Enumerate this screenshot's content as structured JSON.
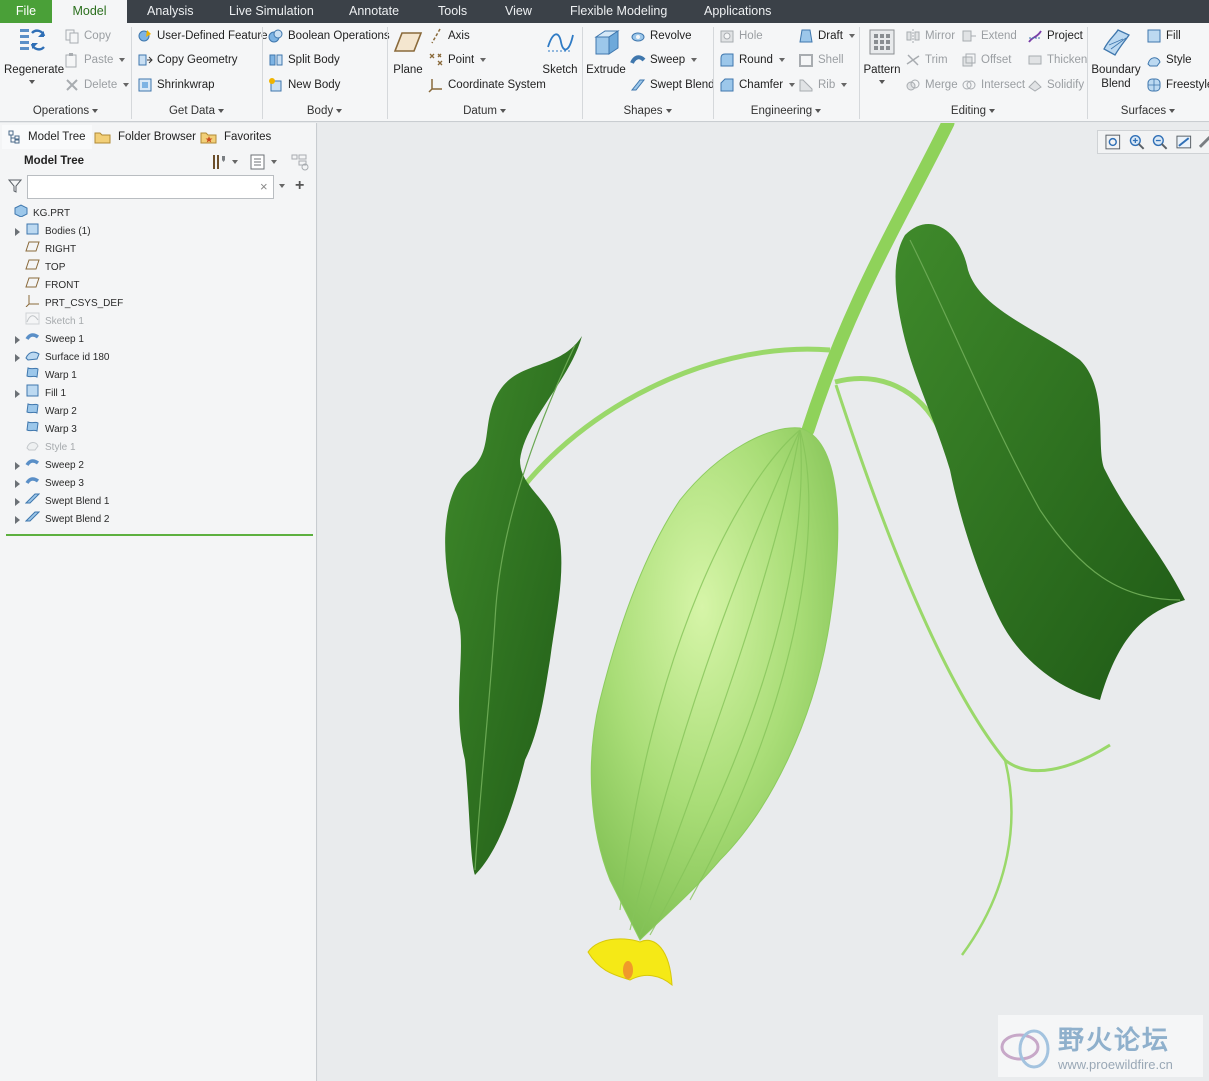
{
  "menubar": {
    "tabs": [
      "File",
      "Model",
      "Analysis",
      "Live Simulation",
      "Annotate",
      "Tools",
      "View",
      "Flexible Modeling",
      "Applications"
    ]
  },
  "ribbon": {
    "operations": {
      "label": "Operations",
      "regenerate": "Regenerate",
      "copy": "Copy",
      "paste": "Paste",
      "delete": "Delete"
    },
    "get_data": {
      "label": "Get Data",
      "user_defined_feature": "User-Defined Feature",
      "copy_geometry": "Copy Geometry",
      "shrinkwrap": "Shrinkwrap"
    },
    "body": {
      "label": "Body",
      "boolean_operations": "Boolean Operations",
      "split_body": "Split Body",
      "new_body": "New Body"
    },
    "datum": {
      "label": "Datum",
      "plane": "Plane",
      "axis": "Axis",
      "point": "Point",
      "coordinate_system": "Coordinate System",
      "sketch": "Sketch"
    },
    "shapes": {
      "label": "Shapes",
      "extrude": "Extrude",
      "revolve": "Revolve",
      "sweep": "Sweep",
      "swept_blend": "Swept Blend"
    },
    "engineering": {
      "label": "Engineering",
      "hole": "Hole",
      "round": "Round",
      "chamfer": "Chamfer",
      "draft": "Draft",
      "shell": "Shell",
      "rib": "Rib"
    },
    "editing": {
      "label": "Editing",
      "pattern": "Pattern",
      "mirror": "Mirror",
      "trim": "Trim",
      "merge": "Merge",
      "extend": "Extend",
      "offset": "Offset",
      "intersect": "Intersect",
      "project": "Project",
      "thicken": "Thicken",
      "solidify": "Solidify"
    },
    "surfaces": {
      "label": "Surfaces",
      "boundary_blend_1": "Boundary",
      "boundary_blend_2": "Blend",
      "fill": "Fill",
      "style": "Style",
      "freestyle": "Freestyle"
    }
  },
  "panel": {
    "tabs": [
      "Model Tree",
      "Folder Browser",
      "Favorites"
    ],
    "header": "Model Tree",
    "filter_placeholder": "",
    "tree": [
      {
        "label": "KG.PRT",
        "expandable": false,
        "dim": false,
        "icon": "part-icon"
      },
      {
        "label": "Bodies (1)",
        "expandable": true,
        "dim": false,
        "icon": "bodies-icon"
      },
      {
        "label": "RIGHT",
        "expandable": false,
        "dim": false,
        "icon": "datum-plane-icon"
      },
      {
        "label": "TOP",
        "expandable": false,
        "dim": false,
        "icon": "datum-plane-icon"
      },
      {
        "label": "FRONT",
        "expandable": false,
        "dim": false,
        "icon": "datum-plane-icon"
      },
      {
        "label": "PRT_CSYS_DEF",
        "expandable": false,
        "dim": false,
        "icon": "csys-icon"
      },
      {
        "label": "Sketch 1",
        "expandable": false,
        "dim": true,
        "icon": "sketch-icon"
      },
      {
        "label": "Sweep 1",
        "expandable": true,
        "dim": false,
        "icon": "sweep-icon"
      },
      {
        "label": "Surface id 180",
        "expandable": true,
        "dim": false,
        "icon": "surface-icon"
      },
      {
        "label": "Warp 1",
        "expandable": false,
        "dim": false,
        "icon": "warp-icon"
      },
      {
        "label": "Fill 1",
        "expandable": true,
        "dim": false,
        "icon": "fill-icon"
      },
      {
        "label": "Warp 2",
        "expandable": false,
        "dim": false,
        "icon": "warp-icon"
      },
      {
        "label": "Warp 3",
        "expandable": false,
        "dim": false,
        "icon": "warp-icon"
      },
      {
        "label": "Style 1",
        "expandable": false,
        "dim": true,
        "icon": "style-icon"
      },
      {
        "label": "Sweep 2",
        "expandable": true,
        "dim": false,
        "icon": "sweep-icon"
      },
      {
        "label": "Sweep 3",
        "expandable": true,
        "dim": false,
        "icon": "sweep-icon"
      },
      {
        "label": "Swept Blend 1",
        "expandable": true,
        "dim": false,
        "icon": "swept-blend-icon"
      },
      {
        "label": "Swept Blend 2",
        "expandable": true,
        "dim": false,
        "icon": "swept-blend-icon"
      }
    ]
  },
  "watermark": {
    "title": "野火论坛",
    "url": "www.proewildfire.cn"
  },
  "colors": {
    "menubar_bg": "#3b4148",
    "file_tab": "#4aa038",
    "active_tab_text": "#2b6f1d",
    "leaf": "#2f6e1e",
    "fruit": "#a9dd77",
    "flower": "#f5e916"
  }
}
